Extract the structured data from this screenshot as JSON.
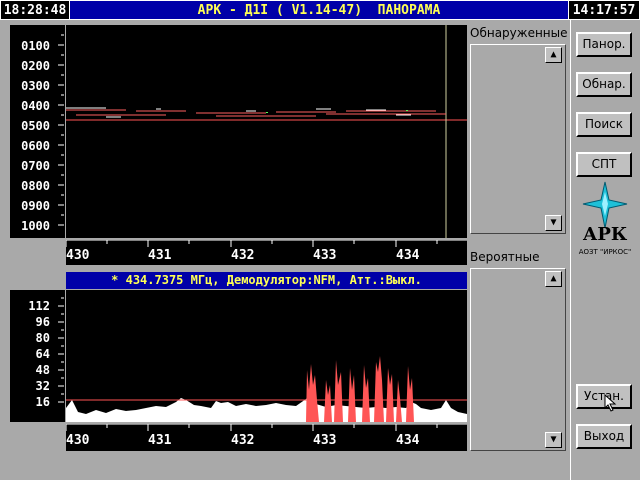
{
  "header": {
    "clock_left": "18:28:48",
    "title": "АРК - Д1I ( V1.14-47)  ПАНОРАМА",
    "clock_right": "14:17:57"
  },
  "panorama": {
    "y_labels": [
      "0100",
      "0200",
      "0300",
      "0400",
      "0500",
      "0600",
      "0700",
      "0800",
      "0900",
      "1000"
    ],
    "x_labels": [
      "430",
      "431",
      "432",
      "433",
      "434"
    ]
  },
  "status": {
    "text": "* 434.7375 МГц, Демодулятор:NFM, Атт.:Выкл."
  },
  "spectrum": {
    "y_labels": [
      "112",
      "96",
      "80",
      "64",
      "48",
      "32",
      "16"
    ],
    "x_labels": [
      "430",
      "431",
      "432",
      "433",
      "434"
    ]
  },
  "panels": {
    "detected_title": "Обнаруженные",
    "probable_title": "Вероятные"
  },
  "buttons": {
    "panor": "Панор.",
    "obnar": "Обнар.",
    "poisk": "Поиск",
    "spt": "СПТ",
    "ustan": "Устан.",
    "vyhod": "Выход"
  },
  "logo": {
    "name": "АРК",
    "company": "АОЗТ \"ИРКОС\""
  },
  "colors": {
    "title_bg": "#0000a8",
    "title_fg": "#ffff55",
    "signal": "#ff5555"
  }
}
